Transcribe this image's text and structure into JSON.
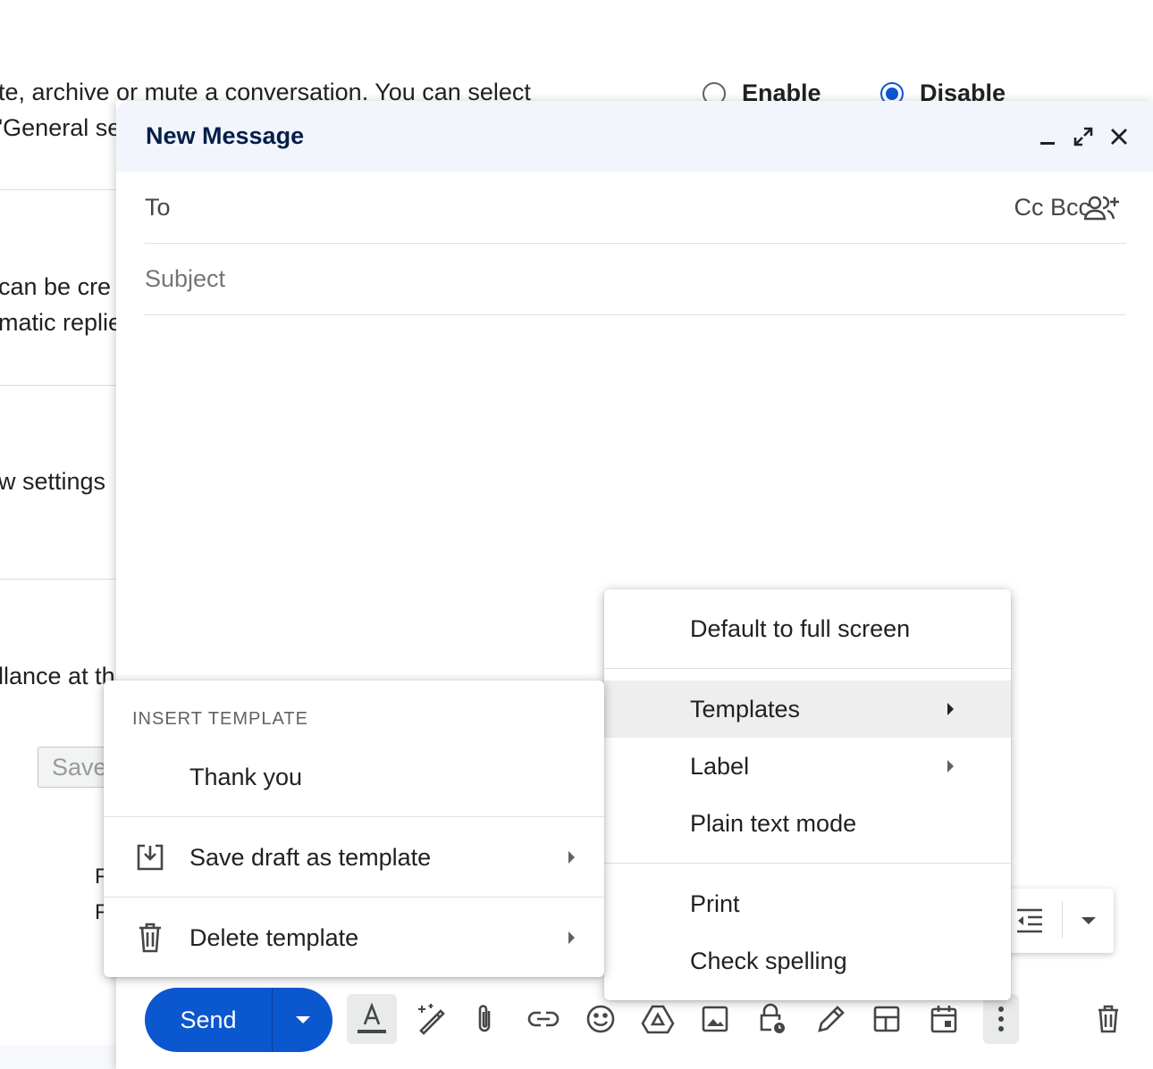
{
  "background": {
    "line1": "te, archive or mute a conversation. You can select",
    "line2": "'General se",
    "line3": "can be cre",
    "line4": "matic replie",
    "line5": "w settings",
    "line6": "llance at th",
    "save_label": "Save",
    "fragment_a": "F",
    "fragment_b": "F",
    "radio_enable": "Enable",
    "radio_disable": "Disable"
  },
  "compose": {
    "title": "New Message",
    "to_label": "To",
    "cc_bcc": "Cc Bcc",
    "subject_placeholder": "Subject",
    "send_label": "Send"
  },
  "more_menu": {
    "items": [
      {
        "label": "Default to full screen"
      },
      {
        "label": "Templates"
      },
      {
        "label": "Label"
      },
      {
        "label": "Plain text mode"
      },
      {
        "label": "Print"
      },
      {
        "label": "Check spelling"
      }
    ]
  },
  "templates_menu": {
    "heading": "INSERT TEMPLATE",
    "thank_you": "Thank you",
    "save_draft": "Save draft as template",
    "delete": "Delete template"
  },
  "colors": {
    "accent": "#0b57d0",
    "header_bg": "#f2f6fc",
    "title": "#041e49"
  }
}
